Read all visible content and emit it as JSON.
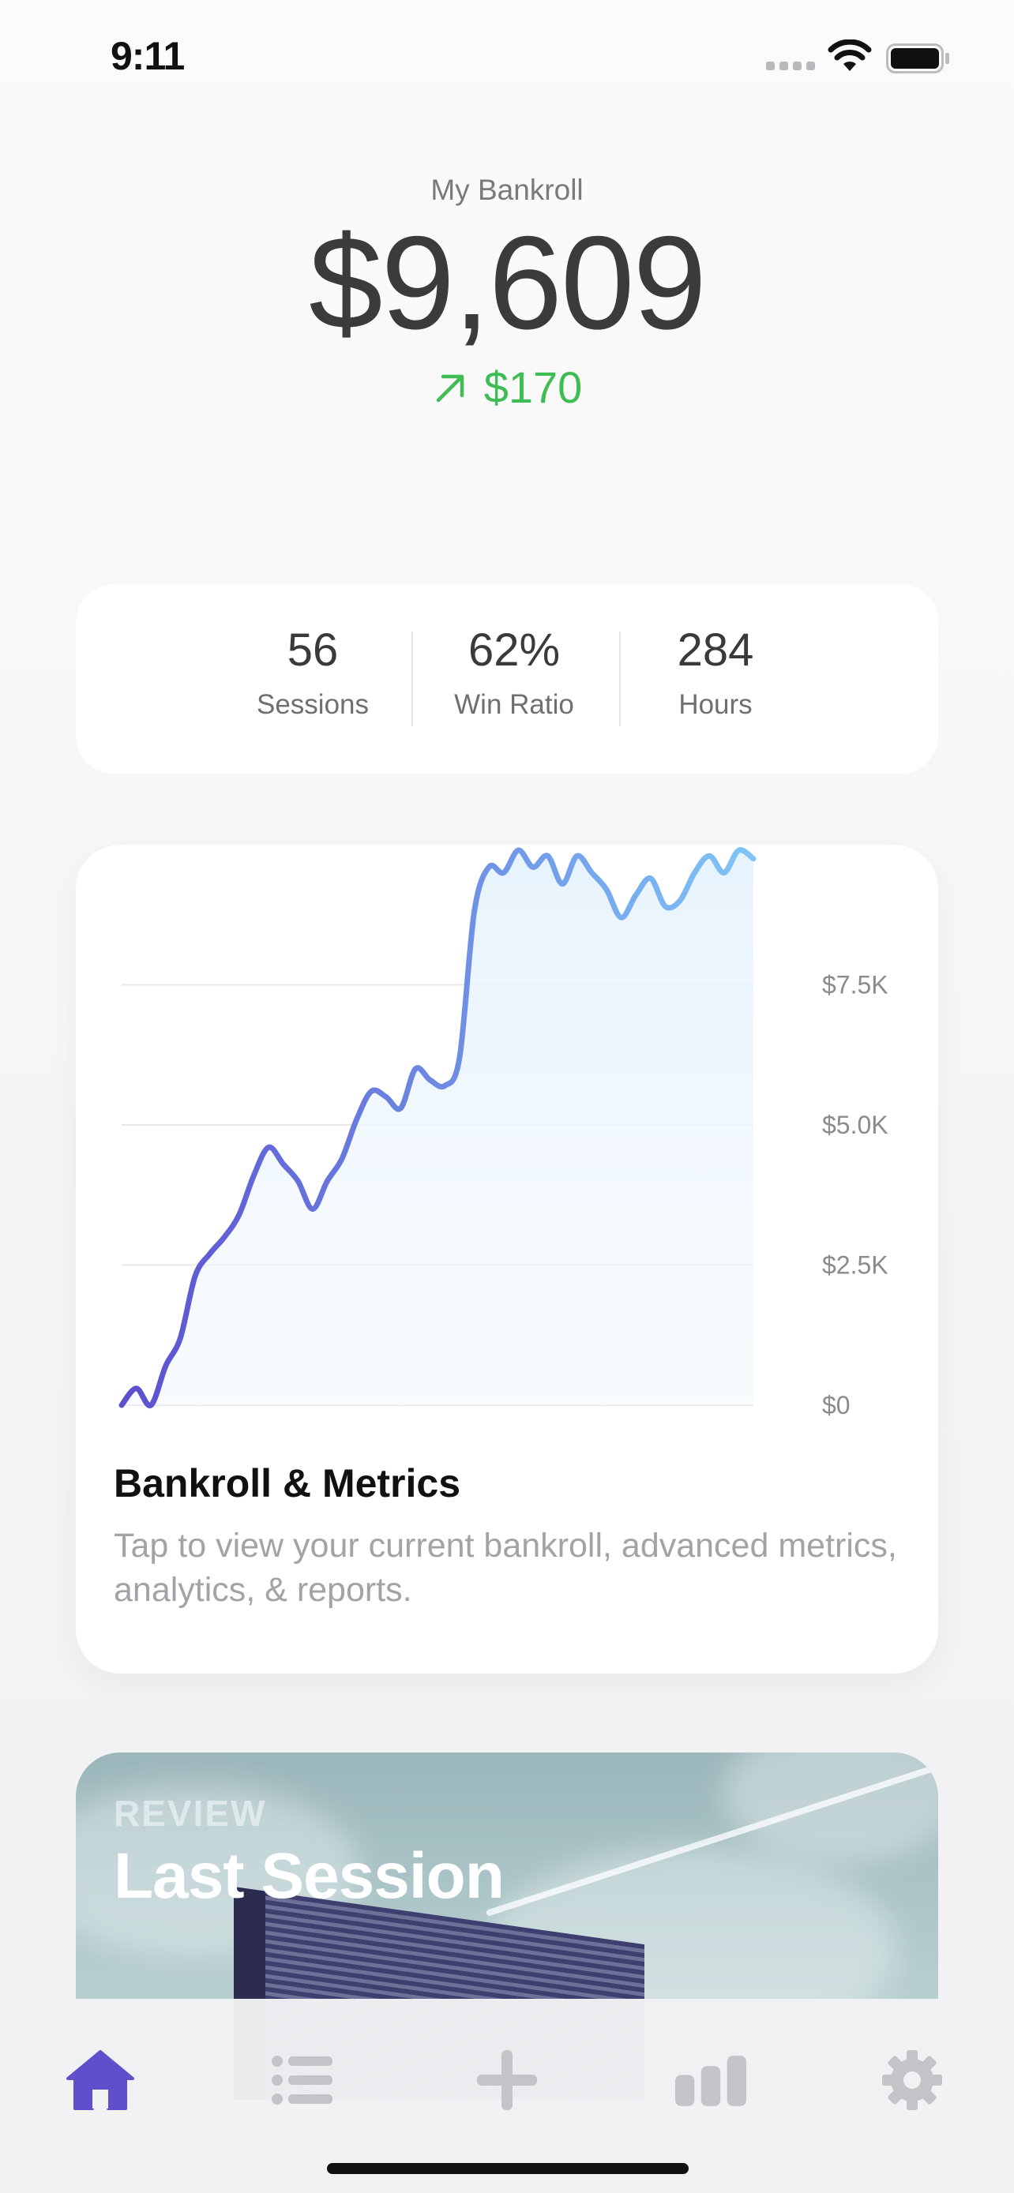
{
  "status_bar": {
    "time": "9:11"
  },
  "bankroll": {
    "label": "My Bankroll",
    "amount": "$9,609",
    "change": "$170",
    "change_direction": "up",
    "change_color": "#3fbd55"
  },
  "stats": [
    {
      "value": "56",
      "label": "Sessions"
    },
    {
      "value": "62%",
      "label": "Win Ratio"
    },
    {
      "value": "284",
      "label": "Hours"
    }
  ],
  "metrics_card": {
    "title": "Bankroll & Metrics",
    "description": "Tap to view your current bankroll, advanced metrics, analytics, & reports."
  },
  "chart_data": {
    "type": "line",
    "title": "",
    "xlabel": "",
    "ylabel": "",
    "ylim": [
      0,
      10000
    ],
    "y_ticks": [
      {
        "value": 0,
        "label": "$0"
      },
      {
        "value": 2500,
        "label": "$2.5K"
      },
      {
        "value": 5000,
        "label": "$5.0K"
      },
      {
        "value": 7500,
        "label": "$7.5K"
      }
    ],
    "grid": true,
    "y_axis_position": "right",
    "gradient_colors": [
      "#5b4fcf",
      "#7fc5f7"
    ],
    "series": [
      {
        "values": [
          0,
          300,
          0,
          700,
          1200,
          2300,
          2700,
          3000,
          3400,
          4100,
          4600,
          4300,
          4000,
          3500,
          4000,
          4400,
          5100,
          5600,
          5500,
          5300,
          6000,
          5800,
          5700,
          6200,
          8800,
          9600,
          9500,
          9900,
          9600,
          9800,
          9300,
          9800,
          9500,
          9200,
          8700,
          9100,
          9400,
          8900,
          9000,
          9500,
          9800,
          9500,
          9900,
          9750
        ]
      }
    ]
  },
  "session_card": {
    "eyebrow": "REVIEW",
    "title": "Last Session"
  },
  "tab_bar": {
    "items": [
      {
        "icon": "home-icon",
        "active": true
      },
      {
        "icon": "list-icon",
        "active": false
      },
      {
        "icon": "plus-icon",
        "active": false
      },
      {
        "icon": "bar-chart-icon",
        "active": false
      },
      {
        "icon": "gear-icon",
        "active": false
      }
    ],
    "active_color": "#5e4fcc",
    "inactive_color": "#c3c3c8"
  }
}
